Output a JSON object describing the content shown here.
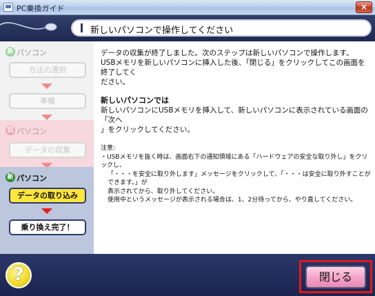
{
  "window": {
    "title": "PC乗換ガイド",
    "close_glyph": "×"
  },
  "header": {
    "title": "新しいパソコンで操作してください"
  },
  "steps": {
    "new_section_label": "パソコン",
    "new_badge": "新",
    "old_section_label": "パソコン",
    "old_badge": "旧",
    "new2_section_label": "パソコン",
    "new2_badge": "新",
    "items": [
      {
        "label": "方法の選択"
      },
      {
        "label": "準備"
      },
      {
        "label": "データの収集"
      },
      {
        "label": "データの取り込み"
      },
      {
        "label": "乗り換え完了！"
      }
    ]
  },
  "content": {
    "intro_line1": "データの収集が終了しました。次のステップは新しいパソコンで操作します。",
    "intro_line2": "USBメモリを新しいパソコンに挿入した後、「閉じる」をクリックしてこの画面を終了してく",
    "intro_line3": "ださい。",
    "section_title": "新しいパソコンでは",
    "body_line1": "新しいパソコンにUSBメモリを挿入して、新しいパソコンに表示されている画面の「次へ",
    "body_line2": "」をクリックしてください。",
    "note_title": "注意:",
    "note_line1": "・USBメモリを抜く時は、画面右下の通知領域にある「ハードウェアの安全な取り外し」をクリックし、",
    "note_line2": "「・・・を安全に取り外します」メッセージをクリックして、「・・・は安全に取り外すことができます。」が",
    "note_line3": "表示されてから、取り外してください。",
    "note_line4": "使用中というメッセージが表示される場合は、1、2分待ってから、やり直してください。"
  },
  "footer": {
    "help_glyph": "?",
    "close_label": "閉じる"
  },
  "colors": {
    "header_bg": "#1e2850",
    "current_step": "#ffe63c",
    "arrow": "#e84a4a",
    "close_highlight": "#e21a1a",
    "close_button": "#f3a3c7"
  }
}
